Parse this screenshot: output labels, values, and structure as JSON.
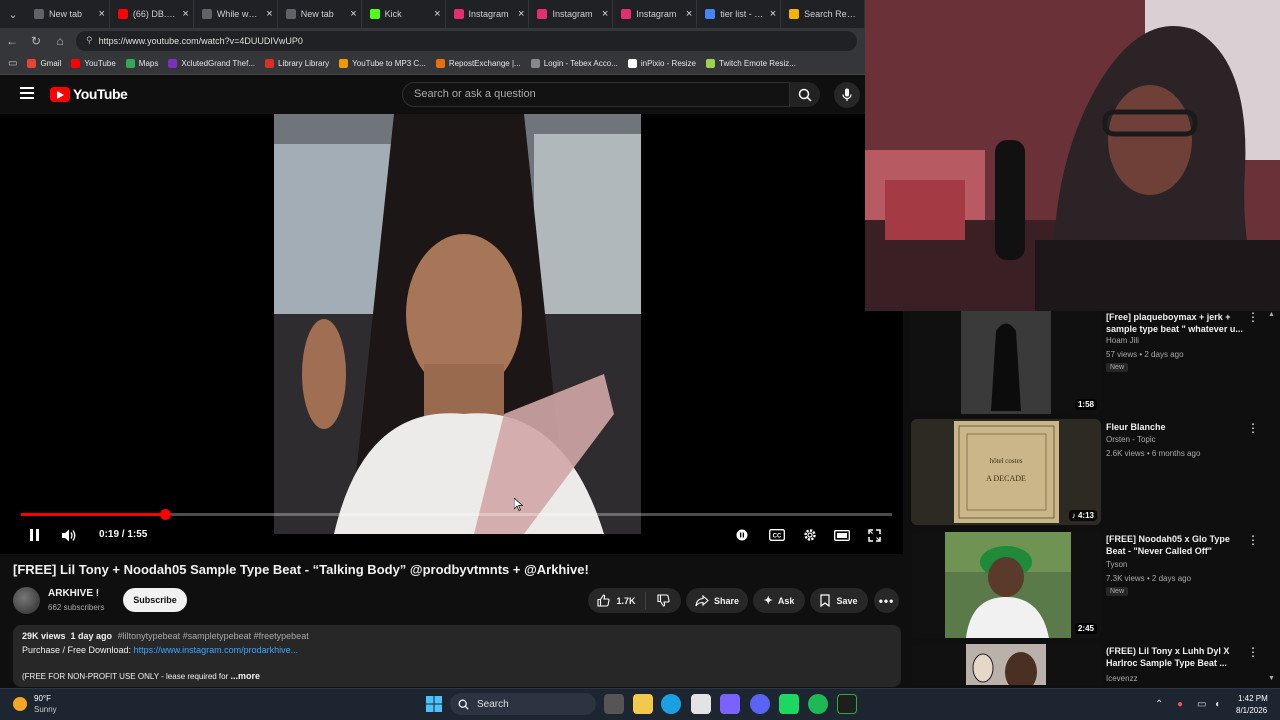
{
  "browser": {
    "tabs": [
      {
        "label": "New tab",
        "fav_color": "#5f6368"
      },
      {
        "label": "(66) DB.Bout",
        "fav_color": "#ff0000"
      },
      {
        "label": "While we wa",
        "fav_color": "#5f6368"
      },
      {
        "label": "New tab",
        "fav_color": "#5f6368"
      },
      {
        "label": "Kick",
        "fav_color": "#53fc18"
      },
      {
        "label": "Instagram",
        "fav_color": "#e1306c"
      },
      {
        "label": "Instagram",
        "fav_color": "#e1306c"
      },
      {
        "label": "Instagram",
        "fav_color": "#e1306c"
      },
      {
        "label": "tier list - Sear",
        "fav_color": "#4285f4"
      },
      {
        "label": "Search Result",
        "fav_color": "#f4b400"
      }
    ],
    "url": "https://www.youtube.com/watch?v=4DUUDIVwUP0",
    "bookmarks": [
      {
        "label": "Gmail",
        "fav_color": "#ea4335"
      },
      {
        "label": "YouTube",
        "fav_color": "#ff0000"
      },
      {
        "label": "Maps",
        "fav_color": "#34a853"
      },
      {
        "label": "XclutedGrand Thef...",
        "fav_color": "#7b2fbf"
      },
      {
        "label": "Library Library",
        "fav_color": "#d93025"
      },
      {
        "label": "YouTube to MP3 C...",
        "fav_color": "#f29900"
      },
      {
        "label": "RepostExchange |...",
        "fav_color": "#e8710a"
      },
      {
        "label": "Login - Tebex Acco...",
        "fav_color": "#888888"
      },
      {
        "label": "inPixio - Resize",
        "fav_color": "#ffffff"
      },
      {
        "label": "Twitch Emote Resiz...",
        "fav_color": "#9bd34a"
      }
    ]
  },
  "youtube": {
    "logo_text": "YouTube",
    "search_placeholder": "Search or ask a question",
    "player": {
      "time": "0:19 / 1:55",
      "progress": 0.165
    },
    "video": {
      "title": "[FREE] Lil Tony + Noodah05 Sample Type Beat - “Talking Body” @prodbyvtmnts + @Arkhive!",
      "channel": "ARKHIVE !",
      "subscribers": "662 subscribers",
      "subscribe_label": "Subscribe",
      "likes": "1.7K",
      "share_label": "Share",
      "ask_label": "Ask",
      "save_label": "Save",
      "views_date": "29K views  1 day ago",
      "tags": "#liltonytypebeat #sampletypebeat #freetypebeat",
      "desc_line2_prefix": "Purchase / Free Download:",
      "desc_line2_link": "https://www.instagram.com/prodarkhive...",
      "desc_line3": "(FREE FOR NON-PROFIT USE ONLY - lease required for",
      "more_label": "...more"
    },
    "recommendations": [
      {
        "title": "[Free] plaqueboymax + jerk + sample type beat \" whatever u...",
        "channel": "Hoam Jili",
        "meta": "57 views • 2 days ago",
        "badge": "New",
        "duration": "1:58",
        "thumb_color": "#2a2a2a"
      },
      {
        "title": "Fleur Blanche",
        "channel": "Orsten - Topic",
        "meta": "2.6K views • 6 months ago",
        "badge": "",
        "duration": "4:13",
        "thumb_color": "#c9b78a",
        "album_text_1": "hôtel costes",
        "album_text_2": "A DECADE"
      },
      {
        "title": "[FREE] Noodah05 x Glo Type Beat - \"Never Called Off\"",
        "channel": "Tyson",
        "meta": "7.3K views • 2 days ago",
        "badge": "New",
        "duration": "2:45",
        "thumb_color": "#3b6b2e"
      },
      {
        "title": "(FREE) Lil Tony x Luhh Dyl X Harlroc Sample Type Beat ...",
        "channel": "Icevenzz",
        "meta": "",
        "badge": "",
        "duration": "",
        "thumb_color": "#b9b1aa"
      }
    ]
  },
  "taskbar": {
    "weather_temp": "90°F",
    "weather_desc": "Sunny",
    "search_label": "Search",
    "time": "1:42 PM",
    "date": "8/1/2026"
  }
}
